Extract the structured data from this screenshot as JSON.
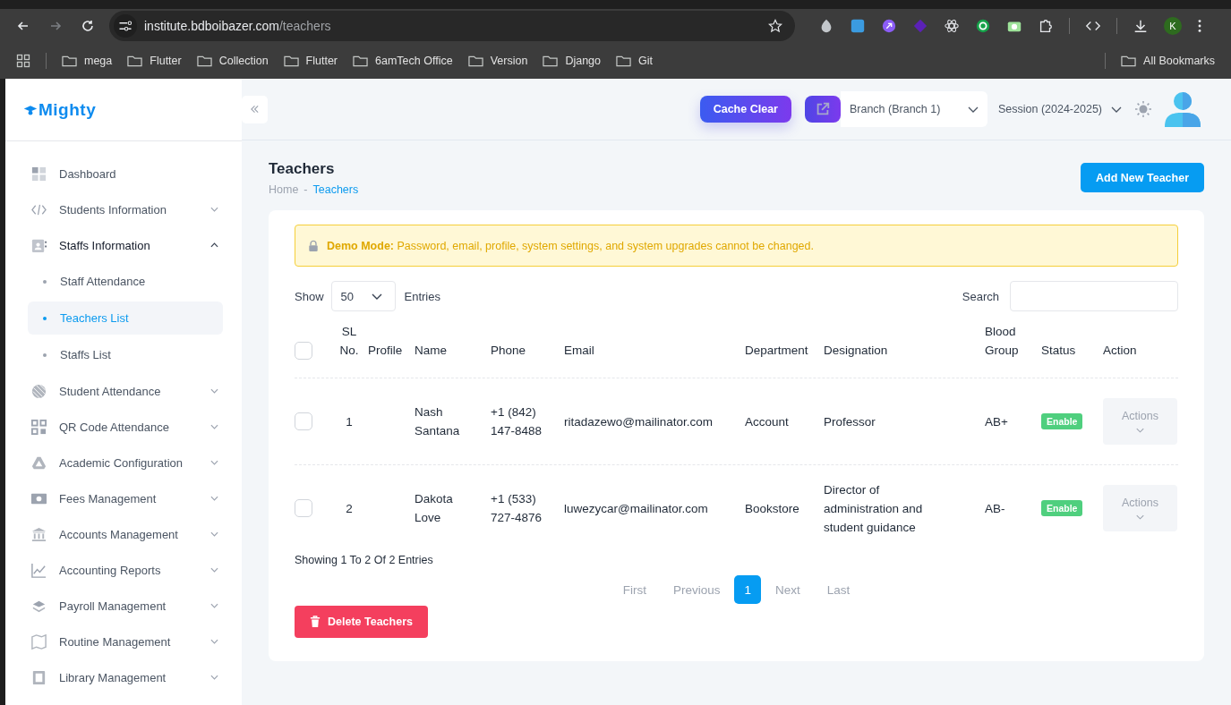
{
  "browser": {
    "url_host": "institute.bdboibazer.com",
    "url_path": "/teachers",
    "profile_initial": "K",
    "bookmarks": [
      "mega",
      "Flutter",
      "Collection",
      "Flutter",
      "6amTech Office",
      "Version",
      "Django",
      "Git"
    ],
    "all_bookmarks": "All Bookmarks"
  },
  "sidebar": {
    "logo": "Mighty",
    "items": [
      {
        "kind": "link",
        "label": "Dashboard"
      },
      {
        "kind": "group",
        "label": "Students Information",
        "expanded": false
      },
      {
        "kind": "group",
        "label": "Staffs Information",
        "expanded": true,
        "children": [
          {
            "label": "Staff Attendance",
            "selected": false
          },
          {
            "label": "Teachers List",
            "selected": true
          },
          {
            "label": "Staffs List",
            "selected": false
          }
        ]
      },
      {
        "kind": "group",
        "label": "Student Attendance",
        "expanded": false
      },
      {
        "kind": "group",
        "label": "QR Code Attendance",
        "expanded": false
      },
      {
        "kind": "group",
        "label": "Academic Configuration",
        "expanded": false
      },
      {
        "kind": "group",
        "label": "Fees Management",
        "expanded": false
      },
      {
        "kind": "group",
        "label": "Accounts Management",
        "expanded": false
      },
      {
        "kind": "group",
        "label": "Accounting Reports",
        "expanded": false
      },
      {
        "kind": "group",
        "label": "Payroll Management",
        "expanded": false
      },
      {
        "kind": "group",
        "label": "Routine Management",
        "expanded": false
      },
      {
        "kind": "group",
        "label": "Library Management",
        "expanded": false
      }
    ]
  },
  "header": {
    "cache_clear": "Cache Clear",
    "branch": "Branch (Branch 1)",
    "session": "Session (2024-2025)"
  },
  "page": {
    "title": "Teachers",
    "breadcrumb": [
      {
        "label": "Home",
        "selected": false
      },
      {
        "label": "Teachers",
        "selected": true
      }
    ],
    "breadcrumb_separator": "-",
    "add_button": "Add New Teacher"
  },
  "alert": {
    "label": "Demo Mode:",
    "text": "Password, email, profile, system settings, and system upgrades cannot be changed."
  },
  "table_controls": {
    "show_label": "Show",
    "page_size": "50",
    "entries_label": "Entries",
    "search_label": "Search"
  },
  "table": {
    "columns": [
      "SL No.",
      "Profile",
      "Name",
      "Phone",
      "Email",
      "Department",
      "Designation",
      "Blood Group",
      "Status",
      "Action"
    ],
    "select_all_checked": false,
    "rows": [
      {
        "checked": false,
        "sl": "1",
        "name": "Nash Santana",
        "phone": "+1 (842) 147-8488",
        "email": "ritadazewo@mailinator.com",
        "department": "Account",
        "designation": "Professor",
        "blood_group": "AB+",
        "status": "Enable",
        "action": "Actions"
      },
      {
        "checked": false,
        "sl": "2",
        "name": "Dakota Love",
        "phone": "+1 (533) 727-4876",
        "email": "luwezycar@mailinator.com",
        "department": "Bookstore",
        "designation": "Director of administration and student guidance",
        "blood_group": "AB-",
        "status": "Enable",
        "action": "Actions"
      }
    ]
  },
  "summary": "Showing 1 To 2 Of 2 Entries",
  "pagination": [
    {
      "label": "First",
      "selected": false
    },
    {
      "label": "Previous",
      "selected": false
    },
    {
      "label": "1",
      "selected": true
    },
    {
      "label": "Next",
      "selected": false
    },
    {
      "label": "Last",
      "selected": false
    }
  ],
  "delete_button": "Delete Teachers"
}
